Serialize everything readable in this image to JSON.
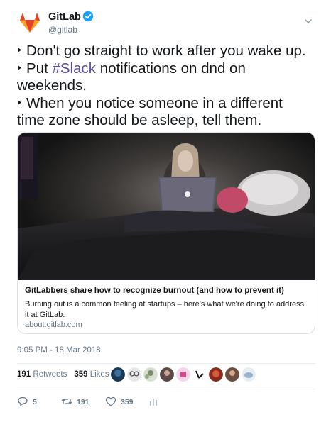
{
  "author": {
    "name": "GitLab",
    "handle": "@gitlab",
    "verified": true,
    "avatar_icon": "gitlab-tanuki-icon"
  },
  "tweet": {
    "lines": [
      "Don't go straight to work after you wake up.",
      "Put ",
      "#Slack",
      " notifications on dnd on",
      "weekends.",
      "When you notice someone in a different",
      "time zone should be asleep, tell them."
    ]
  },
  "card": {
    "image_alt_icon": "woman-laptop-in-bed-photo",
    "title": "GitLabbers share how to recognize burnout (and how to prevent it)",
    "description": "Burning out is a common feeling at startups – here's what we're doing to address it at GitLab.",
    "domain": "about.gitlab.com"
  },
  "timestamp": "9:05 PM - 18 Mar 2018",
  "stats": {
    "retweets_count": "191",
    "retweets_label": "Retweets",
    "likes_count": "359",
    "likes_label": "Likes"
  },
  "actions": {
    "reply_count": "5",
    "retweet_count": "191",
    "like_count": "359"
  },
  "colors": {
    "text": "#14171a",
    "muted": "#657786",
    "hashtag": "#5a4d9a",
    "verified": "#1da1f2",
    "border": "#d9e1e6"
  }
}
